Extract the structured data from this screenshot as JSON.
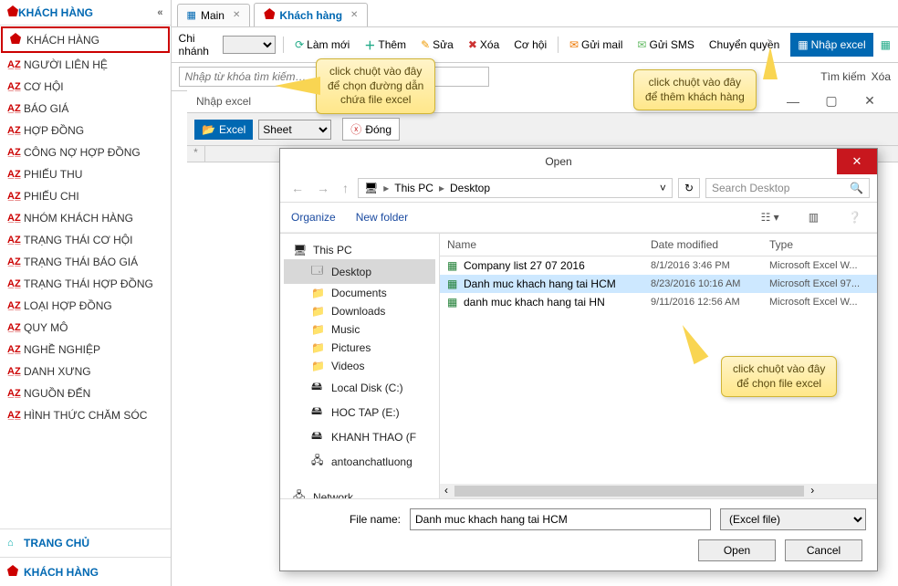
{
  "sidebar": {
    "header": "KHÁCH HÀNG",
    "items": [
      {
        "label": "KHÁCH HÀNG"
      },
      {
        "label": "NGƯỜI LIÊN HỆ"
      },
      {
        "label": "CƠ HỘI"
      },
      {
        "label": "BÁO GIÁ"
      },
      {
        "label": "HỢP ĐỒNG"
      },
      {
        "label": "CÔNG NỢ HỢP ĐỒNG"
      },
      {
        "label": "PHIẾU THU"
      },
      {
        "label": "PHIẾU CHI"
      },
      {
        "label": "NHÓM KHÁCH HÀNG"
      },
      {
        "label": "TRẠNG THÁI CƠ HỘI"
      },
      {
        "label": "TRẠNG THÁI BÁO GIÁ"
      },
      {
        "label": "TRẠNG THÁI HỢP ĐỒNG"
      },
      {
        "label": "LOẠI HỢP ĐỒNG"
      },
      {
        "label": "QUY MÔ"
      },
      {
        "label": "NGHỀ NGHIỆP"
      },
      {
        "label": "DANH XƯNG"
      },
      {
        "label": "NGUỒN ĐẾN"
      },
      {
        "label": "HÌNH THỨC CHĂM SÓC"
      }
    ],
    "footer_home": "TRANG CHỦ",
    "footer_cust": "KHÁCH HÀNG"
  },
  "tabs": {
    "main": "Main",
    "cust": "Khách hàng"
  },
  "toolbar": {
    "chi_nhanh": "Chi nhánh",
    "lam_moi": "Làm mới",
    "them": "Thêm",
    "sua": "Sửa",
    "xoa": "Xóa",
    "co_hoi": "Cơ hội",
    "gui_mail": "Gửi mail",
    "gui_sms": "Gửi SMS",
    "chuyen_quyen": "Chuyển quyền",
    "nhap_excel": "Nhập excel"
  },
  "searchbar": {
    "placeholder": "Nhập từ khóa tìm kiếm…",
    "tim_kiem": "Tìm kiếm",
    "xoa": "Xóa"
  },
  "nhap_panel": {
    "title": "Nhập excel",
    "excel": "Excel",
    "sheet": "Sheet",
    "dong": "Đóng"
  },
  "tooltips": {
    "path_1": "click chuột vào đây",
    "path_2": "để chọn đường dẫn",
    "path_3": "chứa file excel",
    "add_1": "click chuột vào đây",
    "add_2": "để thêm khách hàng",
    "file_1": "click chuột vào đây",
    "file_2": "để chọn file excel"
  },
  "open": {
    "title": "Open",
    "crumb_this_pc": "This PC",
    "crumb_desktop": "Desktop",
    "refresh_icon": "↻",
    "search_ph": "Search Desktop",
    "organize": "Organize",
    "new_folder": "New folder",
    "col_name": "Name",
    "col_date": "Date modified",
    "col_type": "Type",
    "tree": [
      {
        "label": "This PC",
        "level": 1,
        "icon": "🖥"
      },
      {
        "label": "Desktop",
        "level": 2,
        "icon": "🗔",
        "sel": true
      },
      {
        "label": "Documents",
        "level": 2,
        "icon": "📁"
      },
      {
        "label": "Downloads",
        "level": 2,
        "icon": "📁"
      },
      {
        "label": "Music",
        "level": 2,
        "icon": "📁"
      },
      {
        "label": "Pictures",
        "level": 2,
        "icon": "📁"
      },
      {
        "label": "Videos",
        "level": 2,
        "icon": "📁"
      },
      {
        "label": "Local Disk (C:)",
        "level": 2,
        "icon": "🖴"
      },
      {
        "label": "HOC TAP (E:)",
        "level": 2,
        "icon": "🖴"
      },
      {
        "label": "KHANH THAO (F",
        "level": 2,
        "icon": "🖴"
      },
      {
        "label": "antoanchatluong",
        "level": 2,
        "icon": "🖧"
      },
      {
        "label": "Network",
        "level": 1,
        "icon": "🖧"
      }
    ],
    "files": [
      {
        "name": "Company list 27 07 2016",
        "date": "8/1/2016 3:46 PM",
        "type": "Microsoft Excel W..."
      },
      {
        "name": "Danh muc khach hang tai HCM",
        "date": "8/23/2016 10:16 AM",
        "type": "Microsoft Excel 97..."
      },
      {
        "name": "danh muc khach hang tai HN",
        "date": "9/11/2016 12:56 AM",
        "type": "Microsoft Excel W..."
      }
    ],
    "file_name_label": "File name:",
    "file_name_value": "Danh muc khach hang tai HCM",
    "file_type": "(Excel file)",
    "open_btn": "Open",
    "cancel_btn": "Cancel"
  }
}
